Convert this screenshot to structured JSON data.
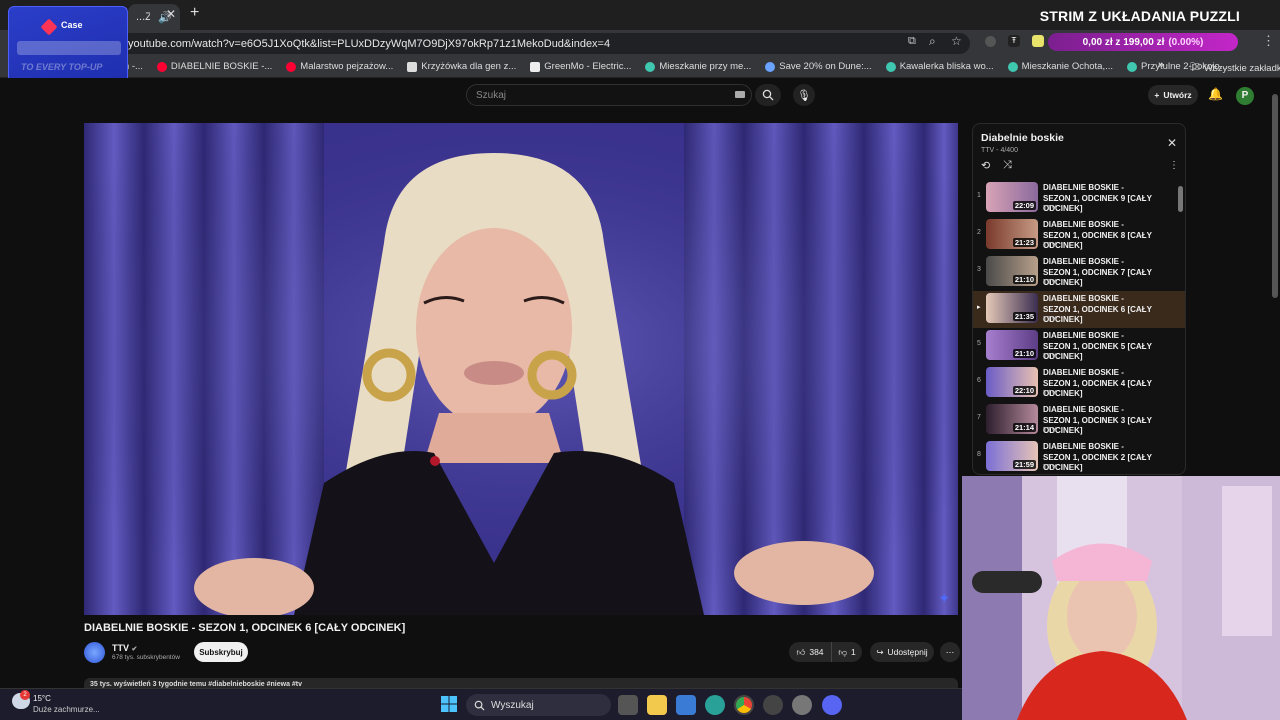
{
  "browser": {
    "tab_title": "...ZON",
    "url": "youtube.com/watch?v=e6O5J1XoQtk&list=PLUxDDzyWqM7O9DjX97okRp71z1MekoDud&index=4",
    "bookmarks": [
      "um -...",
      "DIABELNIE BOSKIE -...",
      "Malarstwo pejzażow...",
      "Krzyżówka dla gen z...",
      "GreenMo - Electric...",
      "Mieszkanie przy me...",
      "Save 20% on Dune:...",
      "Kawalerka bliska wo...",
      "Mieszkanie Ochota,...",
      "Przytulne 2-pokojo..."
    ],
    "all_bookmarks": "Wszystkie zakładki"
  },
  "overlay": {
    "stream_title": "STRIM Z UKŁADANIA PUZZLI",
    "donation_text": "0,00 zł z 199,00 zł",
    "donation_pct": "(0.00%)",
    "case_label": "Case",
    "case_tagline": "TO EVERY TOP-UP"
  },
  "youtube": {
    "search_placeholder": "Szukaj",
    "create_label": "Utwórz",
    "avatar_letter": "P",
    "video_title": "DIABELNIE BOSKIE - SEZON 1, ODCINEK 6 [CAŁY ODCINEK]",
    "channel": "TTV",
    "subscribers": "678 tys. subskrybentów",
    "subscribe_label": "Subskrybuj",
    "likes": "384",
    "dislikes": "1",
    "share_label": "Udostępnij",
    "description_preview": "35 tys. wyświetleń  3 tygodnie temu  #diabelnieboskie #niewa #tv"
  },
  "playlist": {
    "title": "Diabelnie boskie",
    "meta": "TTV - 4/400",
    "items": [
      {
        "index": "1",
        "title": "DIABELNIE BOSKIE - SEZON 1, ODCINEK 9 [CAŁY ODCINEK]",
        "channel": "TTV",
        "duration": "22:09"
      },
      {
        "index": "2",
        "title": "DIABELNIE BOSKIE - SEZON 1, ODCINEK 8 [CAŁY ODCINEK]",
        "channel": "TTV",
        "duration": "21:23"
      },
      {
        "index": "3",
        "title": "DIABELNIE BOSKIE - SEZON 1, ODCINEK 7 [CAŁY ODCINEK]",
        "channel": "TTV",
        "duration": "21:10"
      },
      {
        "index": "▸",
        "title": "DIABELNIE BOSKIE - SEZON 1, ODCINEK 6 [CAŁY ODCINEK]",
        "channel": "TTV",
        "duration": "21:35"
      },
      {
        "index": "5",
        "title": "DIABELNIE BOSKIE - SEZON 1, ODCINEK 5 [CAŁY ODCINEK]",
        "channel": "TTV",
        "duration": "21:10"
      },
      {
        "index": "6",
        "title": "DIABELNIE BOSKIE - SEZON 1, ODCINEK 4 [CAŁY ODCINEK]",
        "channel": "TTV",
        "duration": "22:10"
      },
      {
        "index": "7",
        "title": "DIABELNIE BOSKIE - SEZON 1, ODCINEK 3 [CAŁY ODCINEK]",
        "channel": "TTV",
        "duration": "21:14"
      },
      {
        "index": "8",
        "title": "DIABELNIE BOSKIE - SEZON 1, ODCINEK 2 [CAŁY ODCINEK]",
        "channel": "TTV",
        "duration": "21:59"
      }
    ]
  },
  "taskbar": {
    "weather_temp": "15°C",
    "weather_desc": "Duże zachmurze...",
    "search_label": "Wyszukaj"
  },
  "colors": {
    "accent_red": "#ff0033",
    "donation_pink": "#c326c8",
    "video_purple": "#4a3fa0"
  }
}
